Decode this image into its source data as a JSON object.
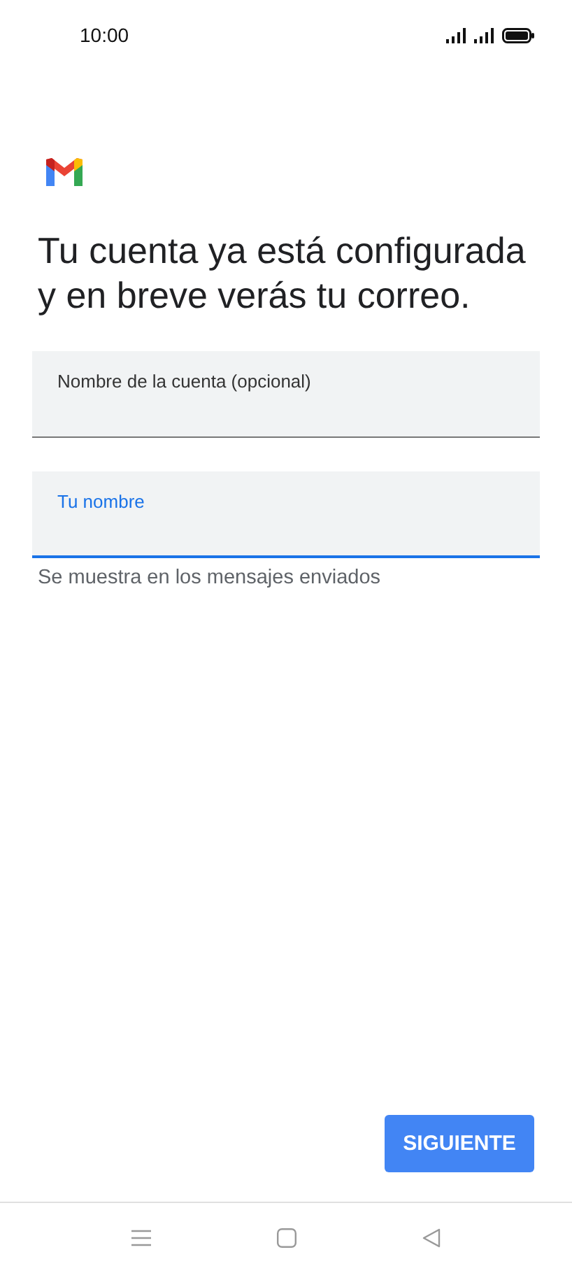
{
  "status_bar": {
    "time": "10:00"
  },
  "heading": "Tu cuenta ya está configurada y en breve verás tu correo.",
  "fields": [
    {
      "label": "Nombre de la cuenta (opcional)",
      "focused": false
    },
    {
      "label": "Tu nombre",
      "focused": true,
      "helper": "Se muestra en los mensajes enviados"
    }
  ],
  "next_button": "SIGUIENTE"
}
